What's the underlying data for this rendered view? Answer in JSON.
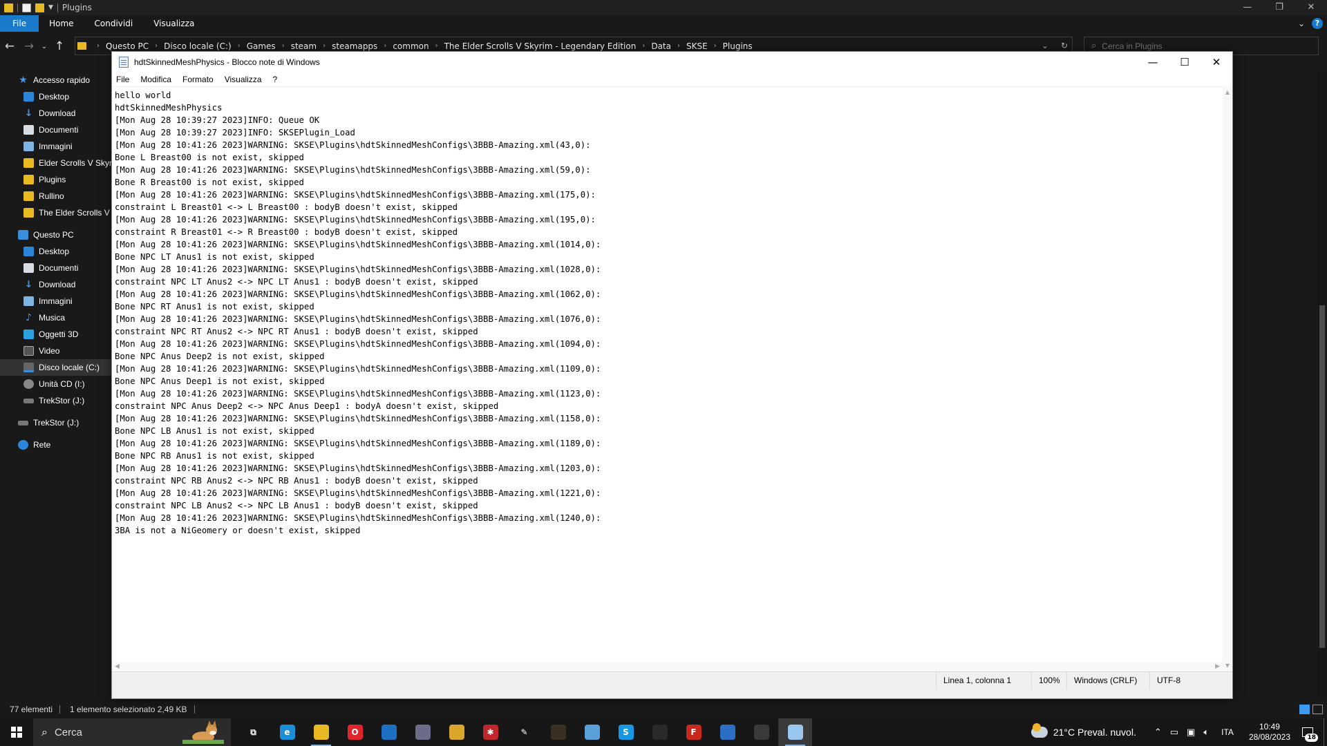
{
  "explorer": {
    "title": "Plugins",
    "ribbon_tabs": [
      "File",
      "Home",
      "Condividi",
      "Visualizza"
    ],
    "breadcrumbs": [
      "Questo PC",
      "Disco locale (C:)",
      "Games",
      "steam",
      "steamapps",
      "common",
      "The Elder Scrolls V Skyrim - Legendary Edition",
      "Data",
      "SKSE",
      "Plugins"
    ],
    "search_placeholder": "Cerca in Plugins",
    "nav": {
      "quick_access": "Accesso rapido",
      "quick_items": [
        "Desktop",
        "Download",
        "Documenti",
        "Immagini",
        "Elder Scrolls V  Skyrim",
        "Plugins",
        "Rullino",
        "The Elder Scrolls V Skyrim"
      ],
      "this_pc": "Questo PC",
      "pc_items": [
        "Desktop",
        "Documenti",
        "Download",
        "Immagini",
        "Musica",
        "Oggetti 3D",
        "Video",
        "Disco locale (C:)",
        "Unità CD (I:)",
        "TrekStor (J:)"
      ],
      "trekstor": "TrekStor (J:)",
      "network": "Rete"
    },
    "status": {
      "count": "77 elementi",
      "selected": "1 elemento selezionato  2,49 KB"
    }
  },
  "notepad": {
    "title": "hdtSkinnedMeshPhysics - Blocco note di Windows",
    "menu": [
      "File",
      "Modifica",
      "Formato",
      "Visualizza",
      "?"
    ],
    "lines": [
      "hello world",
      "hdtSkinnedMeshPhysics",
      "[Mon Aug 28 10:39:27 2023]INFO: Queue OK",
      "[Mon Aug 28 10:39:27 2023]INFO: SKSEPlugin_Load",
      "[Mon Aug 28 10:41:26 2023]WARNING: SKSE\\Plugins\\hdtSkinnedMeshConfigs\\3BBB-Amazing.xml(43,0):",
      "Bone L Breast00 is not exist, skipped",
      "[Mon Aug 28 10:41:26 2023]WARNING: SKSE\\Plugins\\hdtSkinnedMeshConfigs\\3BBB-Amazing.xml(59,0):",
      "Bone R Breast00 is not exist, skipped",
      "[Mon Aug 28 10:41:26 2023]WARNING: SKSE\\Plugins\\hdtSkinnedMeshConfigs\\3BBB-Amazing.xml(175,0):",
      "constraint L Breast01 <-> L Breast00 : bodyB doesn't exist, skipped",
      "[Mon Aug 28 10:41:26 2023]WARNING: SKSE\\Plugins\\hdtSkinnedMeshConfigs\\3BBB-Amazing.xml(195,0):",
      "constraint R Breast01 <-> R Breast00 : bodyB doesn't exist, skipped",
      "[Mon Aug 28 10:41:26 2023]WARNING: SKSE\\Plugins\\hdtSkinnedMeshConfigs\\3BBB-Amazing.xml(1014,0):",
      "Bone NPC LT Anus1 is not exist, skipped",
      "[Mon Aug 28 10:41:26 2023]WARNING: SKSE\\Plugins\\hdtSkinnedMeshConfigs\\3BBB-Amazing.xml(1028,0):",
      "constraint NPC LT Anus2 <-> NPC LT Anus1 : bodyB doesn't exist, skipped",
      "[Mon Aug 28 10:41:26 2023]WARNING: SKSE\\Plugins\\hdtSkinnedMeshConfigs\\3BBB-Amazing.xml(1062,0):",
      "Bone NPC RT Anus1 is not exist, skipped",
      "[Mon Aug 28 10:41:26 2023]WARNING: SKSE\\Plugins\\hdtSkinnedMeshConfigs\\3BBB-Amazing.xml(1076,0):",
      "constraint NPC RT Anus2 <-> NPC RT Anus1 : bodyB doesn't exist, skipped",
      "[Mon Aug 28 10:41:26 2023]WARNING: SKSE\\Plugins\\hdtSkinnedMeshConfigs\\3BBB-Amazing.xml(1094,0):",
      "Bone NPC Anus Deep2 is not exist, skipped",
      "[Mon Aug 28 10:41:26 2023]WARNING: SKSE\\Plugins\\hdtSkinnedMeshConfigs\\3BBB-Amazing.xml(1109,0):",
      "Bone NPC Anus Deep1 is not exist, skipped",
      "[Mon Aug 28 10:41:26 2023]WARNING: SKSE\\Plugins\\hdtSkinnedMeshConfigs\\3BBB-Amazing.xml(1123,0):",
      "constraint NPC Anus Deep2 <-> NPC Anus Deep1 : bodyA doesn't exist, skipped",
      "[Mon Aug 28 10:41:26 2023]WARNING: SKSE\\Plugins\\hdtSkinnedMeshConfigs\\3BBB-Amazing.xml(1158,0):",
      "Bone NPC LB Anus1 is not exist, skipped",
      "[Mon Aug 28 10:41:26 2023]WARNING: SKSE\\Plugins\\hdtSkinnedMeshConfigs\\3BBB-Amazing.xml(1189,0):",
      "Bone NPC RB Anus1 is not exist, skipped",
      "[Mon Aug 28 10:41:26 2023]WARNING: SKSE\\Plugins\\hdtSkinnedMeshConfigs\\3BBB-Amazing.xml(1203,0):",
      "constraint NPC RB Anus2 <-> NPC RB Anus1 : bodyB doesn't exist, skipped",
      "[Mon Aug 28 10:41:26 2023]WARNING: SKSE\\Plugins\\hdtSkinnedMeshConfigs\\3BBB-Amazing.xml(1221,0):",
      "constraint NPC LB Anus2 <-> NPC LB Anus1 : bodyB doesn't exist, skipped",
      "[Mon Aug 28 10:41:26 2023]WARNING: SKSE\\Plugins\\hdtSkinnedMeshConfigs\\3BBB-Amazing.xml(1240,0):",
      "3BA is not a NiGeomery or doesn't exist, skipped"
    ],
    "status": {
      "position": "Linea 1, colonna 1",
      "zoom": "100%",
      "line_ending": "Windows (CRLF)",
      "encoding": "UTF-8"
    }
  },
  "taskbar": {
    "search_placeholder": "Cerca",
    "weather": "21°C  Preval. nuvol.",
    "language": "ITA",
    "time": "10:49",
    "date": "28/08/2023",
    "notification_count": "18",
    "pinned_apps": [
      {
        "name": "task-view-icon",
        "glyph": "⧉",
        "color": "#161616"
      },
      {
        "name": "edge-icon",
        "glyph": "e",
        "color": "#1a8fd8"
      },
      {
        "name": "file-explorer-icon",
        "glyph": "",
        "color": "#e8b923"
      },
      {
        "name": "opera-icon",
        "glyph": "O",
        "color": "#e0262b"
      },
      {
        "name": "store-icon",
        "glyph": "",
        "color": "#1d6fc4"
      },
      {
        "name": "mod-organizer-icon",
        "glyph": "",
        "color": "#6b6b8a"
      },
      {
        "name": "sticky-app-icon",
        "glyph": "",
        "color": "#d9a62b"
      },
      {
        "name": "red-gear-icon",
        "glyph": "✱",
        "color": "#c0262b"
      },
      {
        "name": "pen-icon",
        "glyph": "✎",
        "color": "#161616"
      },
      {
        "name": "skyrim-launcher-icon",
        "glyph": "",
        "color": "#3a3022"
      },
      {
        "name": "paint-icon",
        "glyph": "",
        "color": "#5aa0d8"
      },
      {
        "name": "skype-icon",
        "glyph": "S",
        "color": "#1597e4"
      },
      {
        "name": "monitor-app-icon",
        "glyph": "",
        "color": "#2a2a2a"
      },
      {
        "name": "filezilla-icon",
        "glyph": "F",
        "color": "#c8281d"
      },
      {
        "name": "window-app-icon",
        "glyph": "",
        "color": "#2a6fc4"
      },
      {
        "name": "arrow-app-icon",
        "glyph": "",
        "color": "#3a3a3a"
      },
      {
        "name": "notepad-icon",
        "glyph": "",
        "color": "#9ac7ee"
      }
    ]
  },
  "colors": {
    "accent": "#1979ca",
    "explorer_bg": "#191919",
    "taskbar_bg": "#161616"
  }
}
